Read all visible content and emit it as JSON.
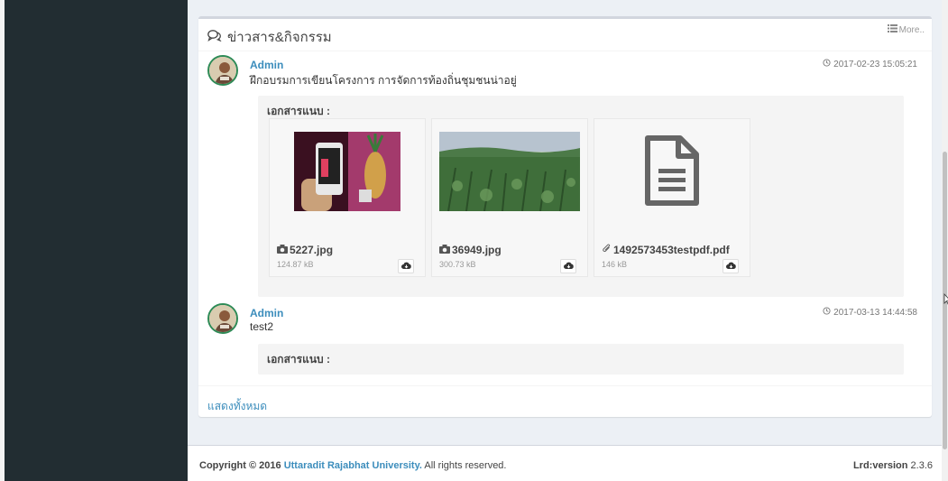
{
  "box": {
    "title": "ข่าวสาร&กิจกรรม",
    "more": "More.."
  },
  "posts": [
    {
      "author": "Admin",
      "text": "ฝึกอบรมการเขียนโครงการ การจัดการท้องถิ่นชุมชนน่าอยู่",
      "date": "2017-02-23 15:05:21",
      "attach_title": "เอกสารแนบ :",
      "attachments": [
        {
          "name": "5227.jpg",
          "size": "124.87 kB",
          "icon": "camera-icon"
        },
        {
          "name": "36949.jpg",
          "size": "300.73 kB",
          "icon": "camera-icon"
        },
        {
          "name": "1492573453testpdf.pdf",
          "size": "146 kB",
          "icon": "paperclip-icon"
        }
      ]
    },
    {
      "author": "Admin",
      "text": "test2",
      "date": "2017-03-13 14:44:58",
      "attach_title": "เอกสารแนบ :",
      "attachments": []
    }
  ],
  "show_all": "แสดงทั้งหมด",
  "footer": {
    "copyright_prefix": "Copyright © 2016",
    "org": "Uttaradit Rajabhat University.",
    "rights": "All rights reserved.",
    "version_label": "Lrd:version",
    "version_value": "2.3.6"
  },
  "colors": {
    "sidebar": "#222d32",
    "link": "#3c8dbc",
    "content_bg": "#ecf0f5"
  }
}
